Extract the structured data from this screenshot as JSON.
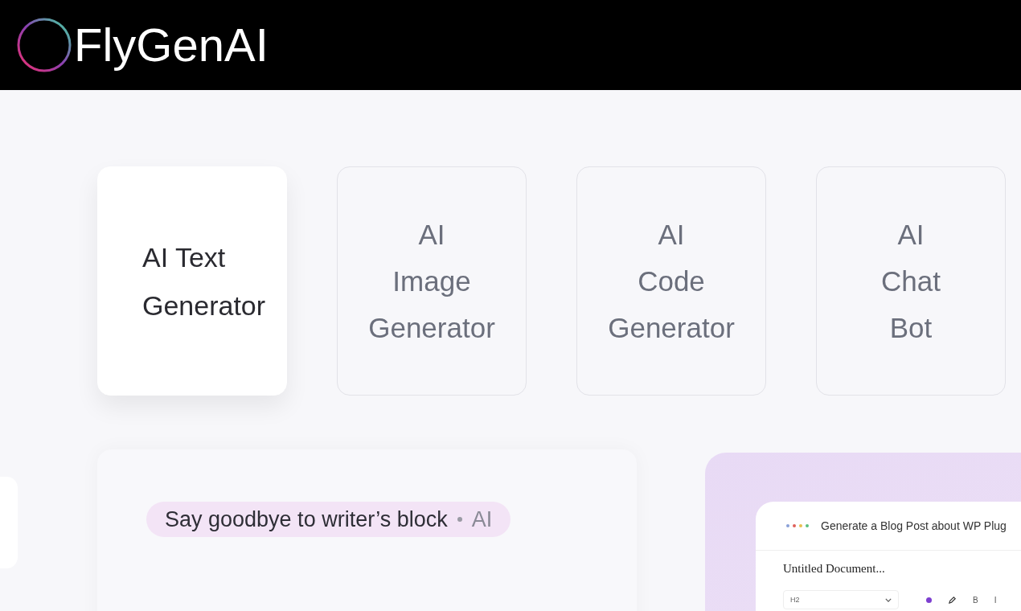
{
  "header": {
    "logo_text": "FlyGenAI"
  },
  "tabs": [
    {
      "label": "AI Text Generator",
      "selected": true
    },
    {
      "label": "AI Image Generator",
      "selected": false
    },
    {
      "label": "AI Code Generator",
      "selected": false
    },
    {
      "label": "AI Chat Bot",
      "selected": false
    }
  ],
  "feature": {
    "badge": {
      "text": "Say goodbye to writer’s block",
      "tag": "AI"
    }
  },
  "preview": {
    "prompt": "Generate a Blog Post about WP Plug",
    "document_title": "Untitled Document...",
    "heading_select": "H2",
    "toolbar": [
      {
        "kind": "color"
      },
      {
        "kind": "pen"
      },
      {
        "kind": "text",
        "label": "B"
      },
      {
        "kind": "text",
        "label": "I"
      }
    ]
  }
}
